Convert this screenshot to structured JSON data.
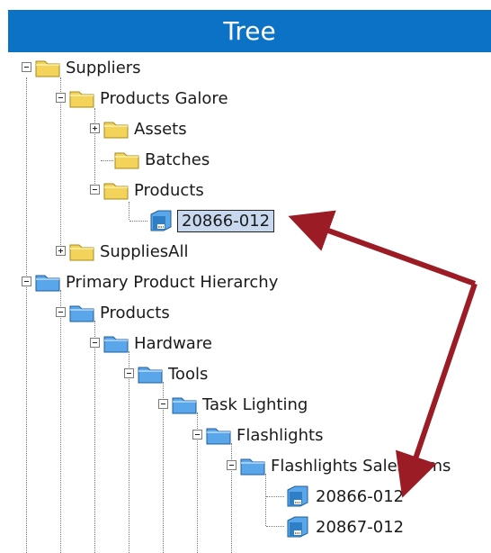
{
  "header": {
    "title": "Tree"
  },
  "colors": {
    "yellow_folder": "#f4d35a",
    "blue_folder": "#5aa6ea",
    "arrow": "#9b1c24",
    "header_bg": "#0b72c6"
  },
  "nodes": [
    {
      "label": "Suppliers",
      "icon": "folder-yellow-icon",
      "toggle": "minus",
      "selected": false
    },
    {
      "label": "Products Galore",
      "icon": "folder-yellow-icon",
      "toggle": "minus",
      "selected": false
    },
    {
      "label": "Assets",
      "icon": "folder-yellow-icon",
      "toggle": "plus",
      "selected": false
    },
    {
      "label": "Batches",
      "icon": "folder-yellow-icon",
      "toggle": "none",
      "selected": false
    },
    {
      "label": "Products",
      "icon": "folder-yellow-icon",
      "toggle": "minus",
      "selected": false
    },
    {
      "label": "20866-012",
      "icon": "product-item-icon",
      "toggle": "none",
      "selected": true
    },
    {
      "label": "SuppliesAll",
      "icon": "folder-yellow-icon",
      "toggle": "plus",
      "selected": false
    },
    {
      "label": "Primary Product Hierarchy",
      "icon": "folder-blue-icon",
      "toggle": "minus",
      "selected": false
    },
    {
      "label": "Products",
      "icon": "folder-blue-icon",
      "toggle": "minus",
      "selected": false
    },
    {
      "label": "Hardware",
      "icon": "folder-blue-icon",
      "toggle": "minus",
      "selected": false
    },
    {
      "label": "Tools",
      "icon": "folder-blue-icon",
      "toggle": "minus",
      "selected": false
    },
    {
      "label": "Task Lighting",
      "icon": "folder-blue-icon",
      "toggle": "minus",
      "selected": false
    },
    {
      "label": "Flashlights",
      "icon": "folder-blue-icon",
      "toggle": "minus",
      "selected": false
    },
    {
      "label": "Flashlights SalesItems",
      "icon": "folder-blue-icon",
      "toggle": "minus",
      "selected": false
    },
    {
      "label": "20866-012",
      "icon": "product-item-icon",
      "toggle": "none",
      "selected": false
    },
    {
      "label": "20867-012",
      "icon": "product-item-icon",
      "toggle": "none",
      "selected": false
    }
  ]
}
